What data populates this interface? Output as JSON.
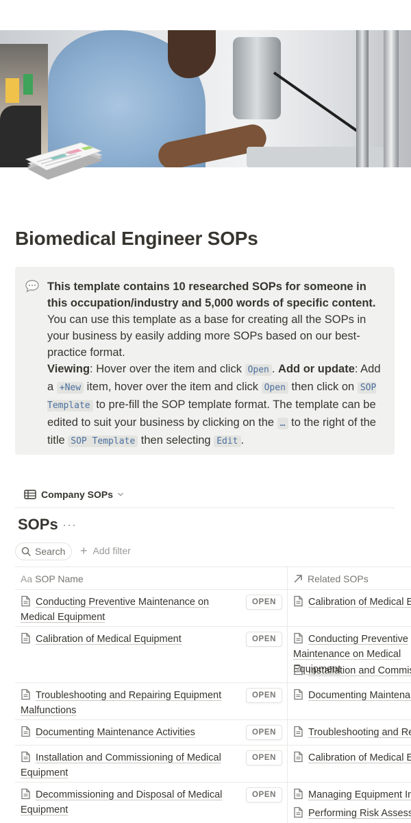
{
  "page": {
    "title": "Biomedical Engineer SOPs"
  },
  "callout": {
    "icon": "speech-bubble-icon",
    "intro_bold": "This template contains 10 researched SOPs for someone in this occupation/industry and 5,000 words of specific content.",
    "intro_rest": " You can use this template as a base for creating all the SOPs in your business by easily adding more SOPs based on our best-practice format.",
    "viewing_label": "Viewing",
    "viewing_text": ": Hover over the item and click ",
    "open_code": "Open",
    "period": ". ",
    "add_label": "Add or update",
    "add_text_1": ": Add a ",
    "new_code": "+New",
    "add_text_2": " item, hover over the item and click ",
    "add_text_3": " then click on ",
    "sop_template_code": "SOP Template",
    "add_text_4": " to pre-fill the SOP template format. The template can be edited to suit your business by clicking on the ",
    "ellipsis_code": "…",
    "add_text_5": " to the right of the title ",
    "add_text_6": " then selecting ",
    "edit_code": "Edit",
    "end": "."
  },
  "database": {
    "view_name": "Company SOPs",
    "title": "SOPs",
    "more": "···",
    "search_label": "Search",
    "add_filter_label": "Add filter",
    "columns": {
      "name": "SOP Name",
      "name_icon": "Aa",
      "related": "Related SOPs"
    },
    "open_label": "OPEN",
    "rows": [
      {
        "name": "Conducting Preventive Maintenance on Medical Equipment",
        "related": [
          "Calibration of Medical Equipment"
        ]
      },
      {
        "name": "Calibration of Medical Equipment",
        "related": [
          "Conducting Preventive Maintenance on Medical Equipment",
          "Installation and Commissioning of Medical Equipment"
        ]
      },
      {
        "name": "Troubleshooting and Repairing Equipment Malfunctions",
        "related": [
          "Documenting Maintenance Activities"
        ]
      },
      {
        "name": "Documenting Maintenance Activities",
        "related": [
          "Troubleshooting and Repairing Equipment Malfunctions"
        ]
      },
      {
        "name": "Installation and Commissioning of Medical Equipment",
        "related": [
          "Calibration of Medical Equipment"
        ]
      },
      {
        "name": "Decommissioning and Disposal of Medical Equipment",
        "related": [
          "Managing Equipment Inventory",
          "Performing Risk Assessments"
        ]
      }
    ]
  }
}
